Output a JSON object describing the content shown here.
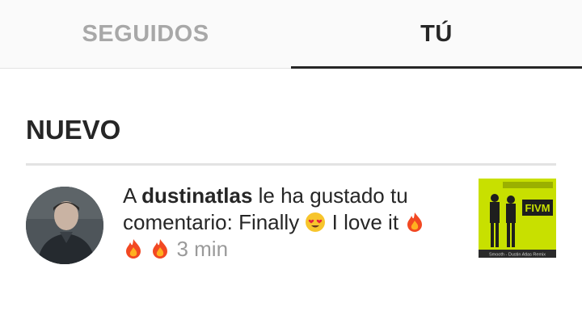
{
  "tabs": {
    "following_label": "SEGUIDOS",
    "you_label": "TÚ"
  },
  "section": {
    "title": "NUEVO"
  },
  "notification": {
    "prefix": "A",
    "username": "dustinatlas",
    "action": "le ha gustado tu comentario: Finally",
    "comment_rest": "I love it",
    "time": "3 min",
    "emojis": [
      "heart-eyes-icon",
      "fire-icon",
      "fire-icon",
      "fire-icon"
    ]
  },
  "thumbnail": {
    "logo_text": "FIVM",
    "footer_text": "Smooth - Dustin Atlas Remix",
    "bg_color": "#c8e000"
  },
  "colors": {
    "primary_text": "#262626",
    "inactive_tab": "#a8a8a8",
    "timestamp": "#9a9a9a",
    "divider": "#e3e3e3"
  }
}
